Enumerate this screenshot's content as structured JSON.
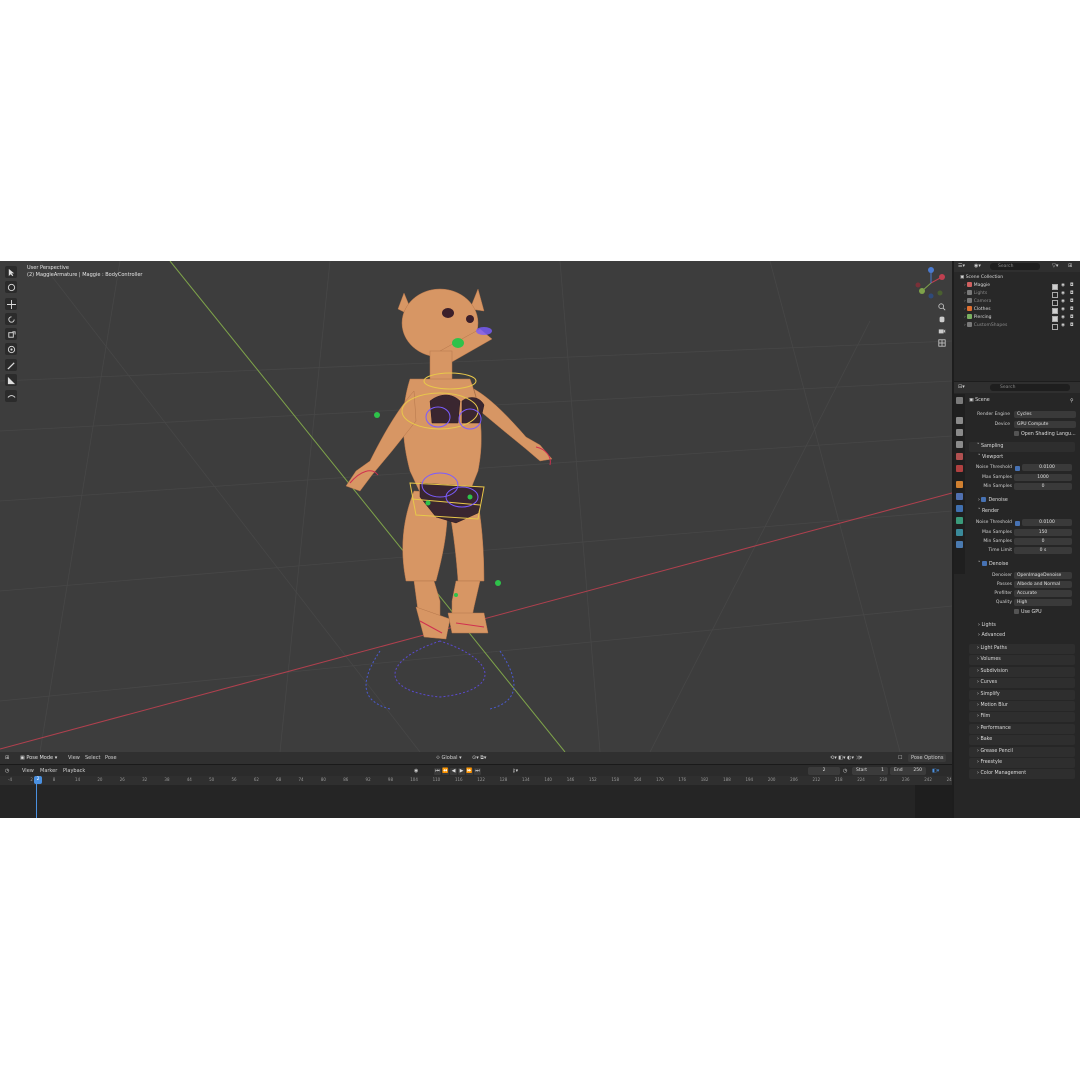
{
  "viewport": {
    "title": "User Perspective",
    "subtitle": "(2) MaggieArmature | Maggie : BodyController"
  },
  "vp_header": {
    "mode": "Pose Mode",
    "menus": [
      "View",
      "Select",
      "Pose"
    ],
    "orientation": "Global",
    "pose_options": "Pose Options"
  },
  "timeline_header": {
    "menus": [
      "View",
      "Marker",
      "Playback"
    ],
    "current_frame": "2",
    "start_label": "Start",
    "start_value": "1",
    "end_label": "End",
    "end_value": "250"
  },
  "timeline": {
    "ticks": [
      "-4",
      "2",
      "8",
      "14",
      "20",
      "26",
      "32",
      "38",
      "44",
      "50",
      "56",
      "62",
      "68",
      "74",
      "80",
      "86",
      "92",
      "98",
      "104",
      "110",
      "116",
      "122",
      "128",
      "134",
      "140",
      "146",
      "152",
      "158",
      "164",
      "170",
      "176",
      "182",
      "188",
      "194",
      "200",
      "206",
      "212",
      "218",
      "224",
      "230",
      "236",
      "242",
      "248"
    ],
    "playhead": "2"
  },
  "outliner": {
    "search_placeholder": "Search",
    "root": "Scene Collection",
    "items": [
      {
        "name": "Maggie",
        "active": true
      },
      {
        "name": "Lights",
        "active": false
      },
      {
        "name": "Camera",
        "active": false
      },
      {
        "name": "Clothes",
        "active": true
      },
      {
        "name": "Piercing",
        "active": true
      },
      {
        "name": "CustomShapes",
        "active": false
      }
    ]
  },
  "properties": {
    "search_placeholder": "Search",
    "context": "Scene",
    "render_engine_label": "Render Engine",
    "render_engine": "Cycles",
    "device_label": "Device",
    "device": "GPU Compute",
    "osl_label": "Open Shading Langu...",
    "sampling": "Sampling",
    "viewport_sub": "Viewport",
    "noise_threshold_label": "Noise Threshold",
    "viewport_noise_threshold": "0.0100",
    "max_samples_label": "Max Samples",
    "viewport_max_samples": "1000",
    "min_samples_label": "Min Samples",
    "viewport_min_samples": "0",
    "denoise_label": "Denoise",
    "render_sub": "Render",
    "render_noise_threshold": "0.0100",
    "render_max_samples": "150",
    "render_min_samples": "0",
    "time_limit_label": "Time Limit",
    "time_limit": "0 s",
    "denoise_sub": "Denoise",
    "denoiser_label": "Denoiser",
    "denoiser": "OpenImageDenoise",
    "passes_label": "Passes",
    "passes": "Albedo and Normal",
    "prefilter_label": "Prefilter",
    "prefilter": "Accurate",
    "quality_label": "Quality",
    "quality": "High",
    "use_gpu_label": "Use GPU",
    "lights_sub": "Lights",
    "advanced_sub": "Advanced",
    "sections": [
      "Light Paths",
      "Volumes",
      "Subdivision",
      "Curves",
      "Simplify",
      "Motion Blur",
      "Film",
      "Performance",
      "Bake",
      "Grease Pencil",
      "Freestyle",
      "Color Management"
    ]
  },
  "colors": {
    "accent": "#4772b3",
    "viewport_bg": "#3d3d3d",
    "x_axis": "#b0404e",
    "y_axis": "#7ea34a",
    "bone_active": "#e8c84a",
    "bone_control": "#7b5cff"
  }
}
